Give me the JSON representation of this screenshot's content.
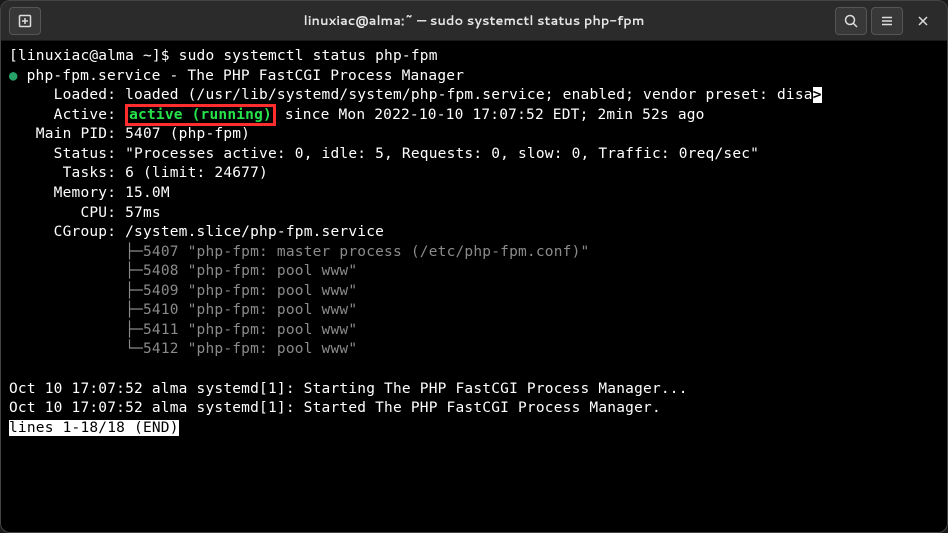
{
  "title": "linuxiac@alma:~ — sudo systemctl status php-fpm",
  "prompt": {
    "user_host": "[linuxiac@alma ~]$ ",
    "command": "sudo systemctl status php-fpm"
  },
  "service": {
    "bullet": "●",
    "name": "php-fpm.service - The PHP FastCGI Process Manager",
    "loaded_label": "     Loaded: ",
    "loaded_value": "loaded (/usr/lib/systemd/system/php-fpm.service; enabled; vendor preset: disa",
    "loaded_truncate": ">",
    "active_label": "     Active: ",
    "active_state": "active (running)",
    "active_since": " since Mon 2022-10-10 17:07:52 EDT; 2min 52s ago",
    "mainpid_label": "   Main PID: ",
    "mainpid_value": "5407 (php-fpm)",
    "status_label": "     Status: ",
    "status_value": "\"Processes active: 0, idle: 5, Requests: 0, slow: 0, Traffic: 0req/sec\"",
    "tasks_label": "      Tasks: ",
    "tasks_value": "6 (limit: 24677)",
    "memory_label": "     Memory: ",
    "memory_value": "15.0M",
    "cpu_label": "        CPU: ",
    "cpu_value": "57ms",
    "cgroup_label": "     CGroup: ",
    "cgroup_value": "/system.slice/php-fpm.service"
  },
  "cgroup_tree": {
    "indent": "             ",
    "lines": [
      "├─5407 \"php-fpm: master process (/etc/php-fpm.conf)\"",
      "├─5408 \"php-fpm: pool www\"",
      "├─5409 \"php-fpm: pool www\"",
      "├─5410 \"php-fpm: pool www\"",
      "├─5411 \"php-fpm: pool www\"",
      "└─5412 \"php-fpm: pool www\""
    ]
  },
  "logs": [
    "Oct 10 17:07:52 alma systemd[1]: Starting The PHP FastCGI Process Manager...",
    "Oct 10 17:07:52 alma systemd[1]: Started The PHP FastCGI Process Manager."
  ],
  "pager_status": "lines 1-18/18 (END)"
}
